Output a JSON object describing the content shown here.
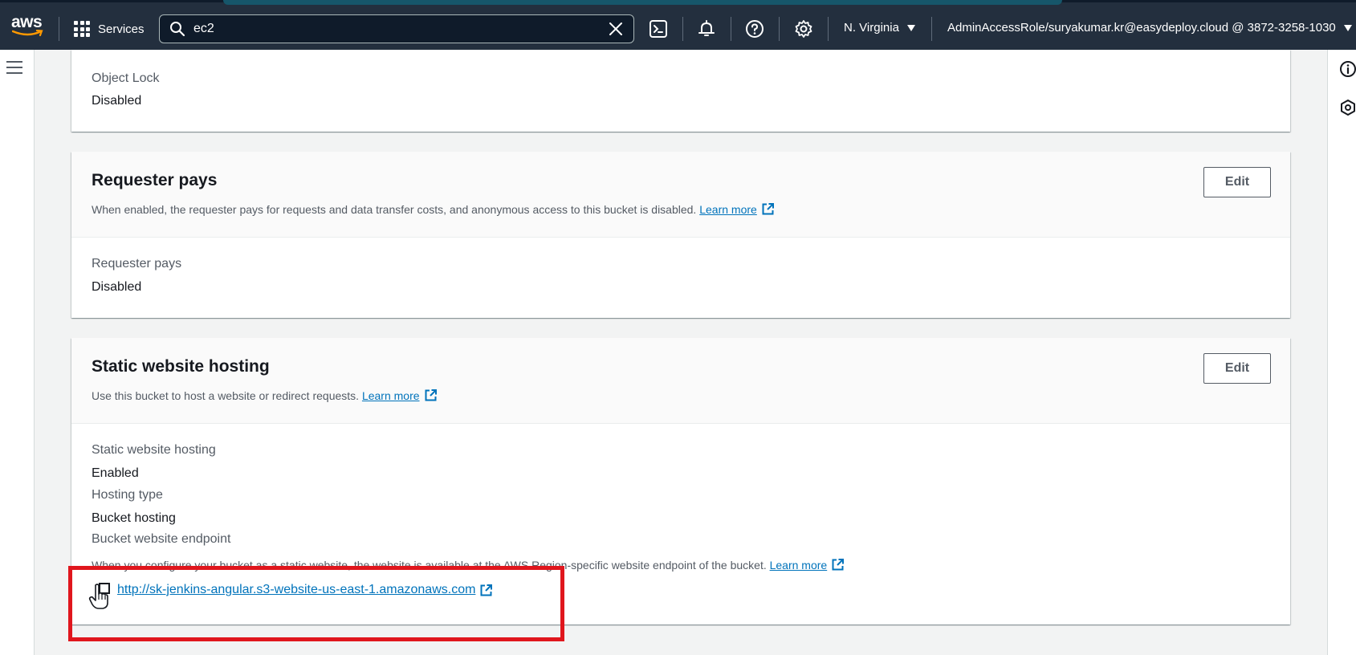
{
  "topnav": {
    "logo": "aws",
    "services_label": "Services",
    "search_value": "ec2",
    "region": "N. Virginia",
    "account": "AdminAccessRole/suryakumar.kr@easydeploy.cloud @ 3872-3258-1030",
    "icons": [
      "grid-icon",
      "search-icon",
      "clear-icon",
      "cloudshell-icon",
      "notifications-icon",
      "help-icon",
      "settings-icon"
    ]
  },
  "object_lock": {
    "label": "Object Lock",
    "value": "Disabled"
  },
  "requester_pays": {
    "title": "Requester pays",
    "description": "When enabled, the requester pays for requests and data transfer costs, and anonymous access to this bucket is disabled.",
    "learn_more": "Learn more",
    "edit_label": "Edit",
    "field_label": "Requester pays",
    "field_value": "Disabled"
  },
  "static_hosting": {
    "title": "Static website hosting",
    "description": "Use this bucket to host a website or redirect requests.",
    "learn_more": "Learn more",
    "edit_label": "Edit",
    "hosting_label": "Static website hosting",
    "hosting_value": "Enabled",
    "type_label": "Hosting type",
    "type_value": "Bucket hosting",
    "endpoint_label": "Bucket website endpoint",
    "endpoint_description": "When you configure your bucket as a static website, the website is available at the AWS Region-specific website endpoint of the bucket.",
    "endpoint_learn_more": "Learn more",
    "endpoint_url": "http://sk-jenkins-angular.s3-website-us-east-1.amazonaws.com"
  },
  "colors": {
    "nav_bg": "#232f3e",
    "link": "#0073bb",
    "highlight": "#e0161d"
  }
}
